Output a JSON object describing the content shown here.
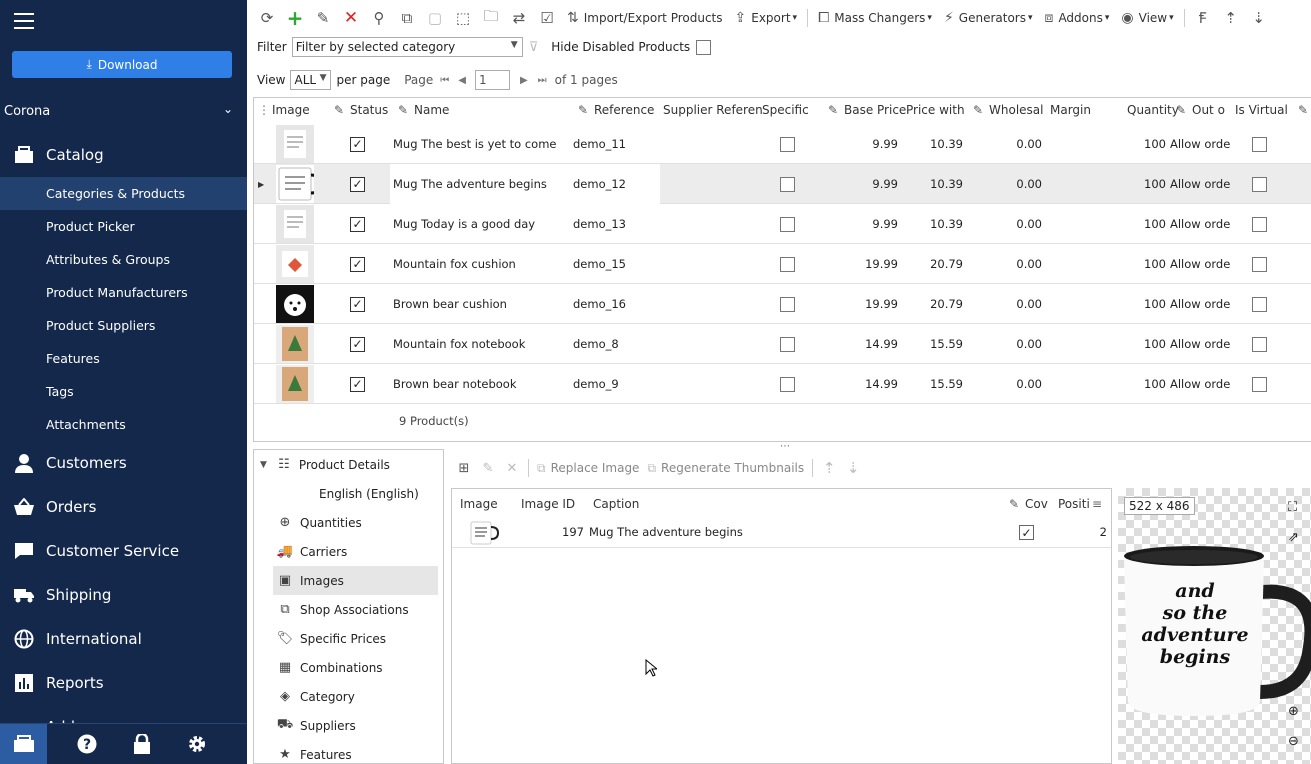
{
  "sidebar": {
    "download_label": "Download",
    "store": "Corona",
    "catalog": "Catalog",
    "sub_items": [
      "Categories & Products",
      "Product Picker",
      "Attributes & Groups",
      "Product Manufacturers",
      "Product Suppliers",
      "Features",
      "Tags",
      "Attachments"
    ],
    "main_items": [
      "Customers",
      "Orders",
      "Customer Service",
      "Shipping",
      "International",
      "Reports",
      "Add..."
    ]
  },
  "toolbar": {
    "import_export": "Import/Export Products",
    "export": "Export",
    "mass_changers": "Mass Changers",
    "generators": "Generators",
    "addons": "Addons",
    "view": "View"
  },
  "filter": {
    "label": "Filter",
    "value": "Filter by selected category",
    "hide_disabled": "Hide Disabled Products"
  },
  "paging": {
    "view": "View",
    "per_page_value": "ALL",
    "per_page": "per page",
    "page": "Page",
    "page_value": "1",
    "of_pages": "of 1 pages"
  },
  "grid": {
    "headers": [
      "Image",
      "Status",
      "Name",
      "Reference",
      "Supplier Referen",
      "Specific",
      "Base Price",
      "Price with",
      "Wholesal",
      "Margin",
      "Quantity",
      "Out o",
      "Is Virtual"
    ],
    "rows": [
      {
        "name": "Mug The best is yet to come",
        "ref": "demo_11",
        "base": "9.99",
        "with": "10.39",
        "wholesale": "0.00",
        "qty": "100",
        "out": "Allow orde",
        "thumb": "mug-white"
      },
      {
        "name": "Mug The adventure begins",
        "ref": "demo_12",
        "base": "9.99",
        "with": "10.39",
        "wholesale": "0.00",
        "qty": "100",
        "out": "Allow orde",
        "thumb": "mug-black"
      },
      {
        "name": "Mug Today is a good day",
        "ref": "demo_13",
        "base": "9.99",
        "with": "10.39",
        "wholesale": "0.00",
        "qty": "100",
        "out": "Allow orde",
        "thumb": "mug-white"
      },
      {
        "name": "Mountain fox cushion",
        "ref": "demo_15",
        "base": "19.99",
        "with": "20.79",
        "wholesale": "0.00",
        "qty": "100",
        "out": "Allow orde",
        "thumb": "cushion-fox"
      },
      {
        "name": "Brown bear cushion",
        "ref": "demo_16",
        "base": "19.99",
        "with": "20.79",
        "wholesale": "0.00",
        "qty": "100",
        "out": "Allow orde",
        "thumb": "cushion-bear"
      },
      {
        "name": "Mountain fox notebook",
        "ref": "demo_8",
        "base": "14.99",
        "with": "15.59",
        "wholesale": "0.00",
        "qty": "100",
        "out": "Allow orde",
        "thumb": "notebook"
      },
      {
        "name": "Brown bear notebook",
        "ref": "demo_9",
        "base": "14.99",
        "with": "15.59",
        "wholesale": "0.00",
        "qty": "100",
        "out": "Allow orde",
        "thumb": "notebook"
      }
    ],
    "footer": "9 Product(s)"
  },
  "details": {
    "root": "Product Details",
    "language": "English (English)",
    "items": [
      "Quantities",
      "Carriers",
      "Images",
      "Shop Associations",
      "Specific Prices",
      "Combinations",
      "Category",
      "Suppliers",
      "Features"
    ]
  },
  "images": {
    "replace": "Replace Image",
    "regenerate": "Regenerate Thumbnails",
    "headers": [
      "Image",
      "Image ID",
      "Caption",
      "Cov",
      "Positi"
    ],
    "row": {
      "id": "197",
      "caption": "Mug The adventure begins",
      "position": "2"
    },
    "dimensions": "522 x 486",
    "mug_text": [
      "and",
      "so the",
      "adventure",
      "begins"
    ]
  },
  "colors": {
    "sidebar": "#13284b",
    "accent": "#2f7fe6",
    "selected": "#22416e"
  }
}
